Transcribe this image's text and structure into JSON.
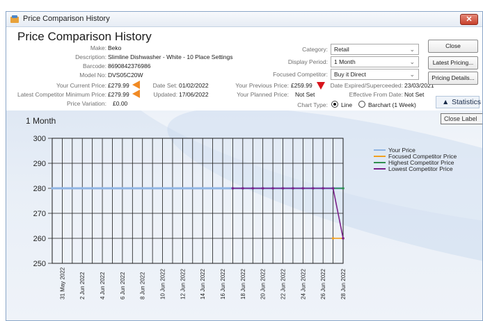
{
  "window": {
    "title": "Price Comparison History",
    "close_glyph": "✕"
  },
  "page_title": "Price Comparison History",
  "product": {
    "make_label": "Make:",
    "make": "Beko",
    "description_label": "Description:",
    "description": "Slimline Dishwasher - White - 10 Place Settings",
    "barcode_label": "Barcode:",
    "barcode": "8690842376986",
    "model_label": "Model No:",
    "model": "DVS05C20W"
  },
  "pricing": {
    "current_price_label": "Your Current Price:",
    "current_price": "£279.99",
    "date_set_label": "Date Set:",
    "date_set": "01/02/2022",
    "competitor_min_label": "Latest Competitor Minimum Price:",
    "competitor_min": "£279.99",
    "updated_label": "Updated:",
    "updated": "17/06/2022",
    "variation_label": "Price Variation:",
    "variation": "£0.00",
    "previous_price_label": "Your Previous Price:",
    "previous_price": "£259.99",
    "planned_price_label": "Your Planned Price:",
    "planned_price": "Not Set",
    "date_expired_label": "Date Expired/Superceeded:",
    "date_expired": "23/03/2021",
    "effective_from_label": "Effective From Date:",
    "effective_from": "Not Set"
  },
  "filters": {
    "category_label": "Category:",
    "category": "Retail",
    "display_period_label": "Display Period:",
    "display_period": "1 Month",
    "focused_competitor_label": "Focused Competitor:",
    "focused_competitor": "Buy it Direct",
    "chart_type_label": "Chart Type:",
    "chart_type_line": "Line",
    "chart_type_bar": "Barchart (1 Week)",
    "chart_type_selected": "Line"
  },
  "buttons": {
    "close": "Close",
    "latest_pricing": "Latest Pricing...",
    "pricing_details": "Pricing Details...",
    "statistics": "Statistics",
    "statistics_glyph": "▲"
  },
  "tooltip": "Close Label",
  "colors": {
    "your_price": "#8fb4e3",
    "focused_competitor": "#f0a020",
    "highest_competitor": "#2f8f4e",
    "lowest_competitor": "#7a1f8a",
    "orange_marker": "#f08a24",
    "red_marker": "#d8141c"
  },
  "chart_data": {
    "type": "line",
    "title": "1 Month",
    "ylim": [
      250,
      300
    ],
    "yticks": [
      250,
      260,
      270,
      280,
      290,
      300
    ],
    "xlim": [
      0,
      29
    ],
    "x_tick_labels": [
      "31 May 2022",
      "2 Jun 2022",
      "4 Jun 2022",
      "6 Jun 2022",
      "8 Jun 2022",
      "10 Jun 2022",
      "12 Jun 2022",
      "14 Jun 2022",
      "16 Jun 2022",
      "18 Jun 2022",
      "20 Jun 2022",
      "22 Jun 2022",
      "24 Jun 2022",
      "26 Jun 2022",
      "28 Jun 2022"
    ],
    "x_tick_positions": [
      1,
      3,
      5,
      7,
      9,
      11,
      13,
      15,
      17,
      19,
      21,
      23,
      25,
      27,
      29
    ],
    "grid": true,
    "legend_position": "top-right",
    "series": [
      {
        "name": "Your Price",
        "color": "#8fb4e3",
        "points": [
          [
            0,
            280
          ],
          [
            1,
            280
          ],
          [
            2,
            280
          ],
          [
            3,
            280
          ],
          [
            4,
            280
          ],
          [
            5,
            280
          ],
          [
            6,
            280
          ],
          [
            7,
            280
          ],
          [
            8,
            280
          ],
          [
            9,
            280
          ],
          [
            10,
            280
          ],
          [
            11,
            280
          ],
          [
            12,
            280
          ],
          [
            13,
            280
          ],
          [
            14,
            280
          ],
          [
            15,
            280
          ],
          [
            16,
            280
          ],
          [
            17,
            280
          ],
          [
            18,
            280
          ],
          [
            19,
            280
          ],
          [
            20,
            280
          ],
          [
            21,
            280
          ],
          [
            22,
            280
          ],
          [
            23,
            280
          ],
          [
            24,
            280
          ],
          [
            25,
            280
          ],
          [
            26,
            280
          ],
          [
            27,
            280
          ],
          [
            28,
            280
          ],
          [
            29,
            280
          ]
        ]
      },
      {
        "name": "Focused Competitor Price",
        "color": "#f0a020",
        "points": [
          [
            28,
            260
          ],
          [
            29,
            260
          ]
        ]
      },
      {
        "name": "Highest Competitor Price",
        "color": "#2f8f4e",
        "points": [
          [
            28,
            280
          ],
          [
            29,
            280
          ]
        ]
      },
      {
        "name": "Lowest Competitor Price",
        "color": "#7a1f8a",
        "points": [
          [
            18,
            280
          ],
          [
            19,
            280
          ],
          [
            20,
            280
          ],
          [
            21,
            280
          ],
          [
            22,
            280
          ],
          [
            23,
            280
          ],
          [
            24,
            280
          ],
          [
            25,
            280
          ],
          [
            26,
            280
          ],
          [
            27,
            280
          ],
          [
            28,
            280
          ],
          [
            29,
            260
          ]
        ]
      }
    ]
  }
}
